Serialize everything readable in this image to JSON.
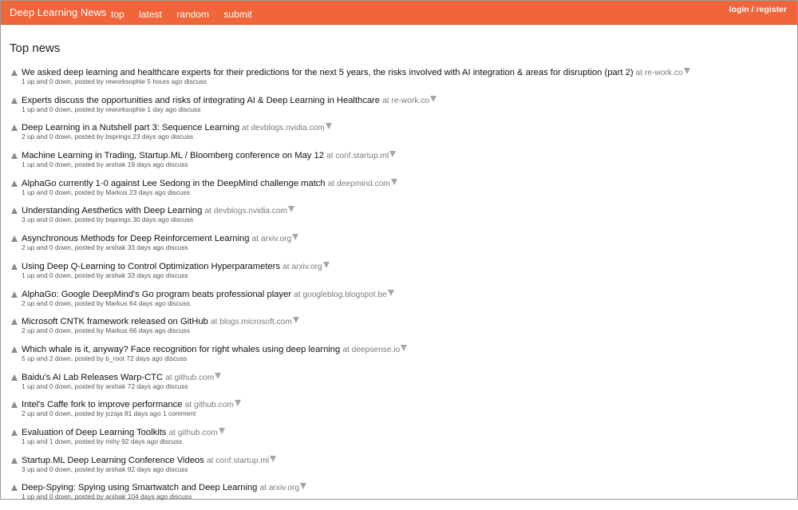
{
  "header": {
    "brand": "Deep Learning News",
    "nav": [
      "top",
      "latest",
      "random",
      "submit"
    ],
    "auth": "login / register"
  },
  "page_title": "Top news",
  "articles": [
    {
      "title": "We asked deep learning and healthcare experts for their predictions for the next 5 years, the risks involved with AI integration & areas for disruption (part 2)",
      "domain": "at re-work.co",
      "votes": "1 up and 0 down, posted by",
      "user": "reworksophie",
      "age": "5 hours ago",
      "link": "discuss"
    },
    {
      "title": "Experts discuss the opportunities and risks of integrating AI & Deep Learning in Healthcare",
      "domain": "at re-work.co",
      "votes": "1 up and 0 down, posted by",
      "user": "reworksophie",
      "age": "1 day ago",
      "link": "discuss"
    },
    {
      "title": "Deep Learning in a Nutshell part 3: Sequence Learning",
      "domain": "at devblogs.nvidia.com",
      "votes": "2 up and 0 down, posted by",
      "user": "bsprings",
      "age": "23 days ago",
      "link": "discuss"
    },
    {
      "title": "Machine Learning in Trading, Startup.ML / Bloomberg conference on May 12",
      "domain": "at conf.startup.ml",
      "votes": "1 up and 0 down, posted by",
      "user": "arshak",
      "age": "19 days ago",
      "link": "discuss"
    },
    {
      "title": "AlphaGo currently 1-0 against Lee Sedong in the DeepMind challenge match",
      "domain": "at deepmind.com",
      "votes": "1 up and 0 down, posted by",
      "user": "Markus",
      "age": "23 days ago",
      "link": "discuss"
    },
    {
      "title": "Understanding Aesthetics with Deep Learning",
      "domain": "at devblogs.nvidia.com",
      "votes": "3 up and 0 down, posted by",
      "user": "bsprings",
      "age": "30 days ago",
      "link": "discuss"
    },
    {
      "title": "Asynchronous Methods for Deep Reinforcement Learning",
      "domain": "at arxiv.org",
      "votes": "2 up and 0 down, posted by",
      "user": "arshak",
      "age": "33 days ago",
      "link": "discuss"
    },
    {
      "title": "Using Deep Q-Learning to Control Optimization Hyperparameters",
      "domain": "at arxiv.org",
      "votes": "1 up and 0 down, posted by",
      "user": "arshak",
      "age": "33 days ago",
      "link": "discuss"
    },
    {
      "title": "AlphaGo: Google DeepMind's Go program beats professional player",
      "domain": "at googleblog.blogspot.be",
      "votes": "2 up and 0 down, posted by",
      "user": "Markus",
      "age": "64 days ago",
      "link": "discuss"
    },
    {
      "title": "Microsoft CNTK framework released on GitHub",
      "domain": "at blogs.microsoft.com",
      "votes": "2 up and 0 down, posted by",
      "user": "Markus",
      "age": "66 days ago",
      "link": "discuss"
    },
    {
      "title": "Which whale is it, anyway? Face recognition for right whales using deep learning",
      "domain": "at deepsense.io",
      "votes": "5 up and 2 down, posted by",
      "user": "b_root",
      "age": "72 days ago",
      "link": "discuss"
    },
    {
      "title": "Baidu's AI Lab Releases Warp-CTC",
      "domain": "at github.com",
      "votes": "1 up and 0 down, posted by",
      "user": "arshak",
      "age": "72 days ago",
      "link": "discuss"
    },
    {
      "title": "Intel's Caffe fork to improve performance",
      "domain": "at github.com",
      "votes": "2 up and 0 down, posted by",
      "user": "jczaja",
      "age": "81 days ago",
      "link": "1 comment"
    },
    {
      "title": "Evaluation of Deep Learning Toolkits",
      "domain": "at github.com",
      "votes": "1 up and 1 down, posted by",
      "user": "rishy",
      "age": "92 days ago",
      "link": "discuss"
    },
    {
      "title": "Startup.ML Deep Learning Conference Videos",
      "domain": "at conf.startup.ml",
      "votes": "3 up and 0 down, posted by",
      "user": "arshak",
      "age": "92 days ago",
      "link": "discuss"
    },
    {
      "title": "Deep-Spying: Spying using Smartwatch and Deep Learning",
      "domain": "at arxiv.org",
      "votes": "1 up and 0 down, posted by",
      "user": "arshak",
      "age": "104 days ago",
      "link": "discuss"
    }
  ]
}
